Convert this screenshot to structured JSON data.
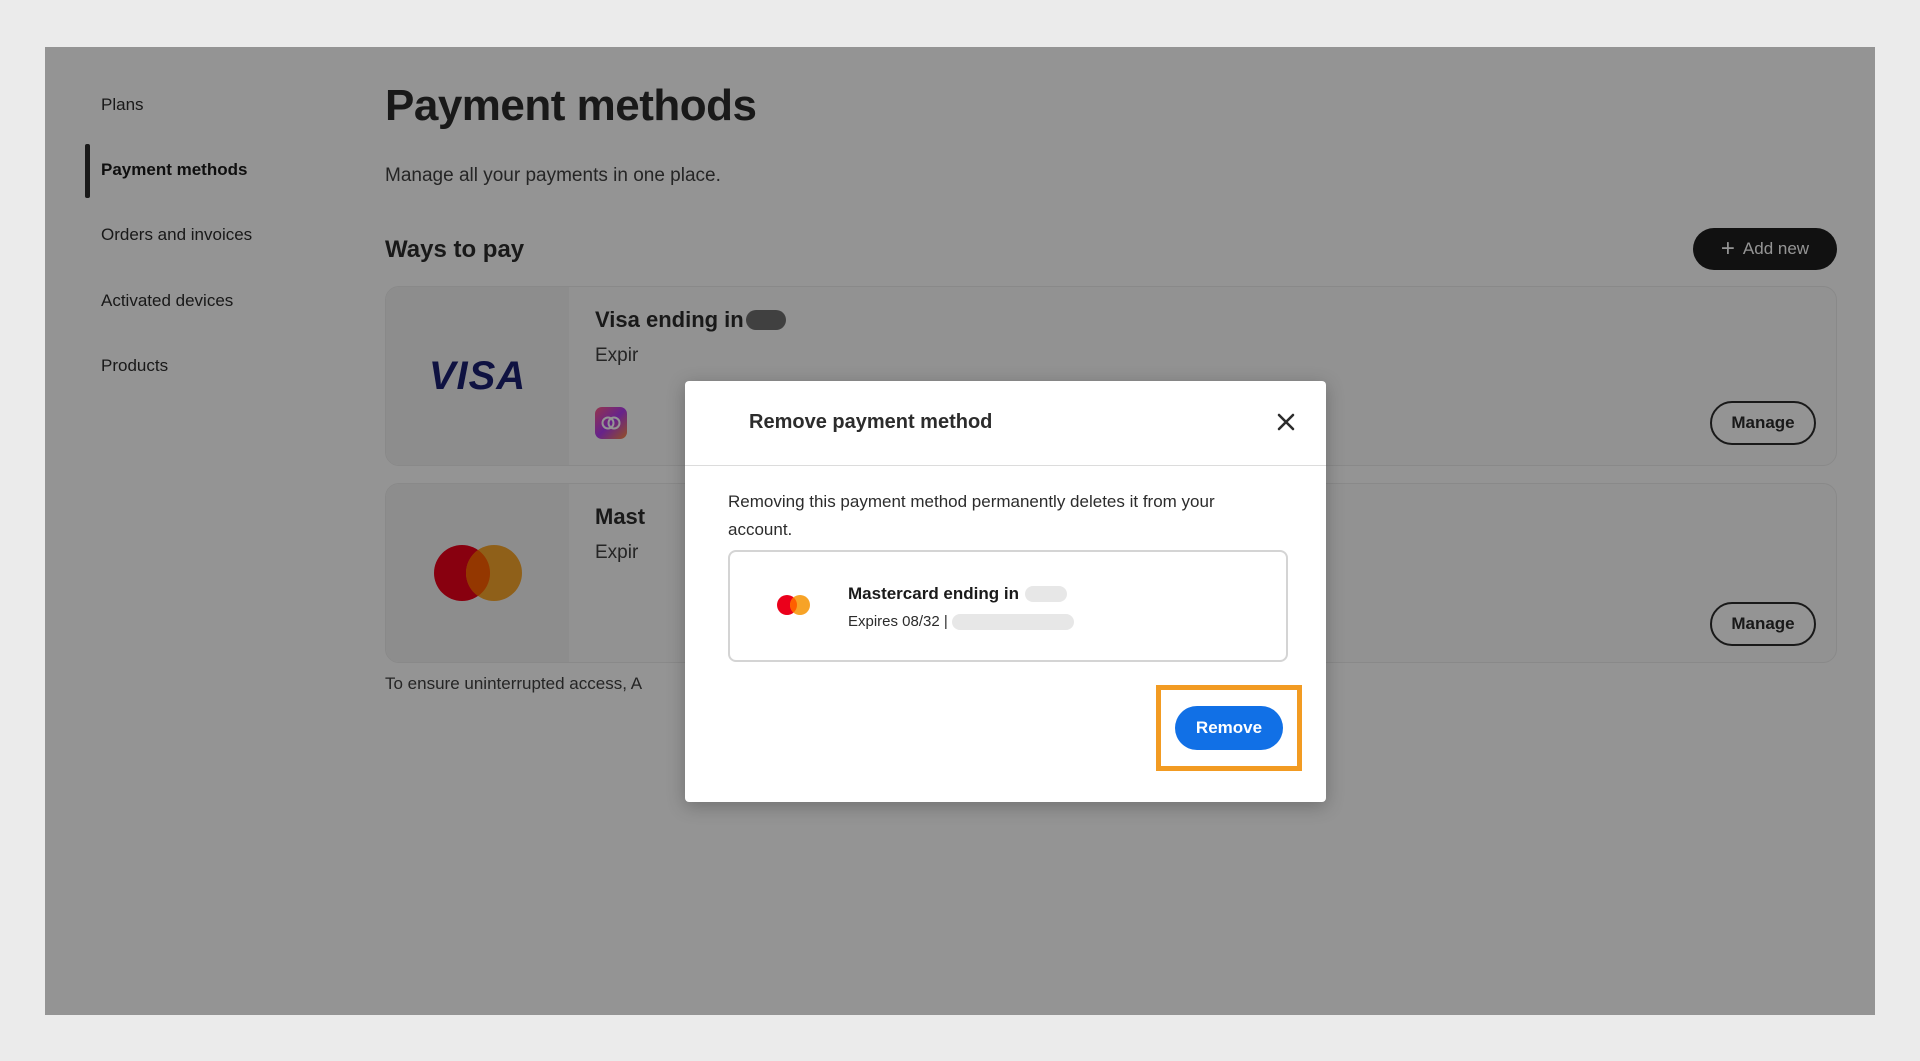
{
  "sidebar": {
    "items": [
      {
        "label": "Plans"
      },
      {
        "label": "Payment methods"
      },
      {
        "label": "Orders and invoices"
      },
      {
        "label": "Activated devices"
      },
      {
        "label": "Products"
      }
    ]
  },
  "main": {
    "title": "Payment methods",
    "subtitle": "Manage all your payments in one place.",
    "section_heading": "Ways to pay",
    "add_new_label": "Add new",
    "cards": [
      {
        "title": "Visa ending in",
        "expiry": "Expir",
        "brand": "VISA",
        "manage_label": "Manage"
      },
      {
        "title": "Mast",
        "expiry": "Expir",
        "manage_label": "Manage"
      }
    ],
    "footnote": "To ensure uninterrupted access, A"
  },
  "modal": {
    "title": "Remove payment method",
    "close_icon": "close-icon",
    "body": "Removing this payment method permanently deletes it from your account.",
    "card": {
      "title": "Mastercard ending in",
      "expiry": "Expires 08/32 |"
    },
    "remove_label": "Remove"
  },
  "colors": {
    "accent": "#1170e6",
    "highlight": "#f29b22",
    "dark_button": "#1e1e1e",
    "visa_blue": "#1a1f71",
    "mastercard_red": "#eb001b",
    "mastercard_orange": "#f79e1b"
  }
}
